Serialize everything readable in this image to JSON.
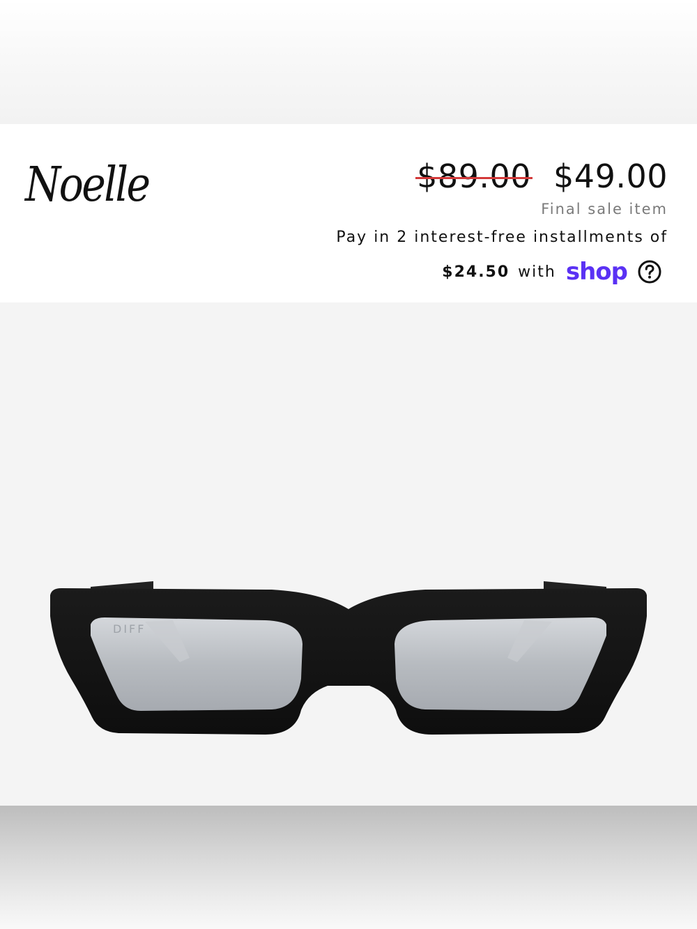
{
  "product": {
    "name": "Noelle",
    "original_price": "$89.00",
    "sale_price": "$49.00",
    "sale_note": "Final sale item",
    "image_brand": "DIFF"
  },
  "installments": {
    "text": "Pay in 2 interest-free installments of",
    "amount": "$24.50",
    "with": "with",
    "provider": "shop",
    "provider_color": "#5a31f4",
    "help_icon": "question-circle-icon"
  },
  "colors": {
    "strike": "#d43a3a",
    "text": "#111111",
    "muted": "#7a7a7a",
    "image_bg": "#f4f4f4"
  }
}
